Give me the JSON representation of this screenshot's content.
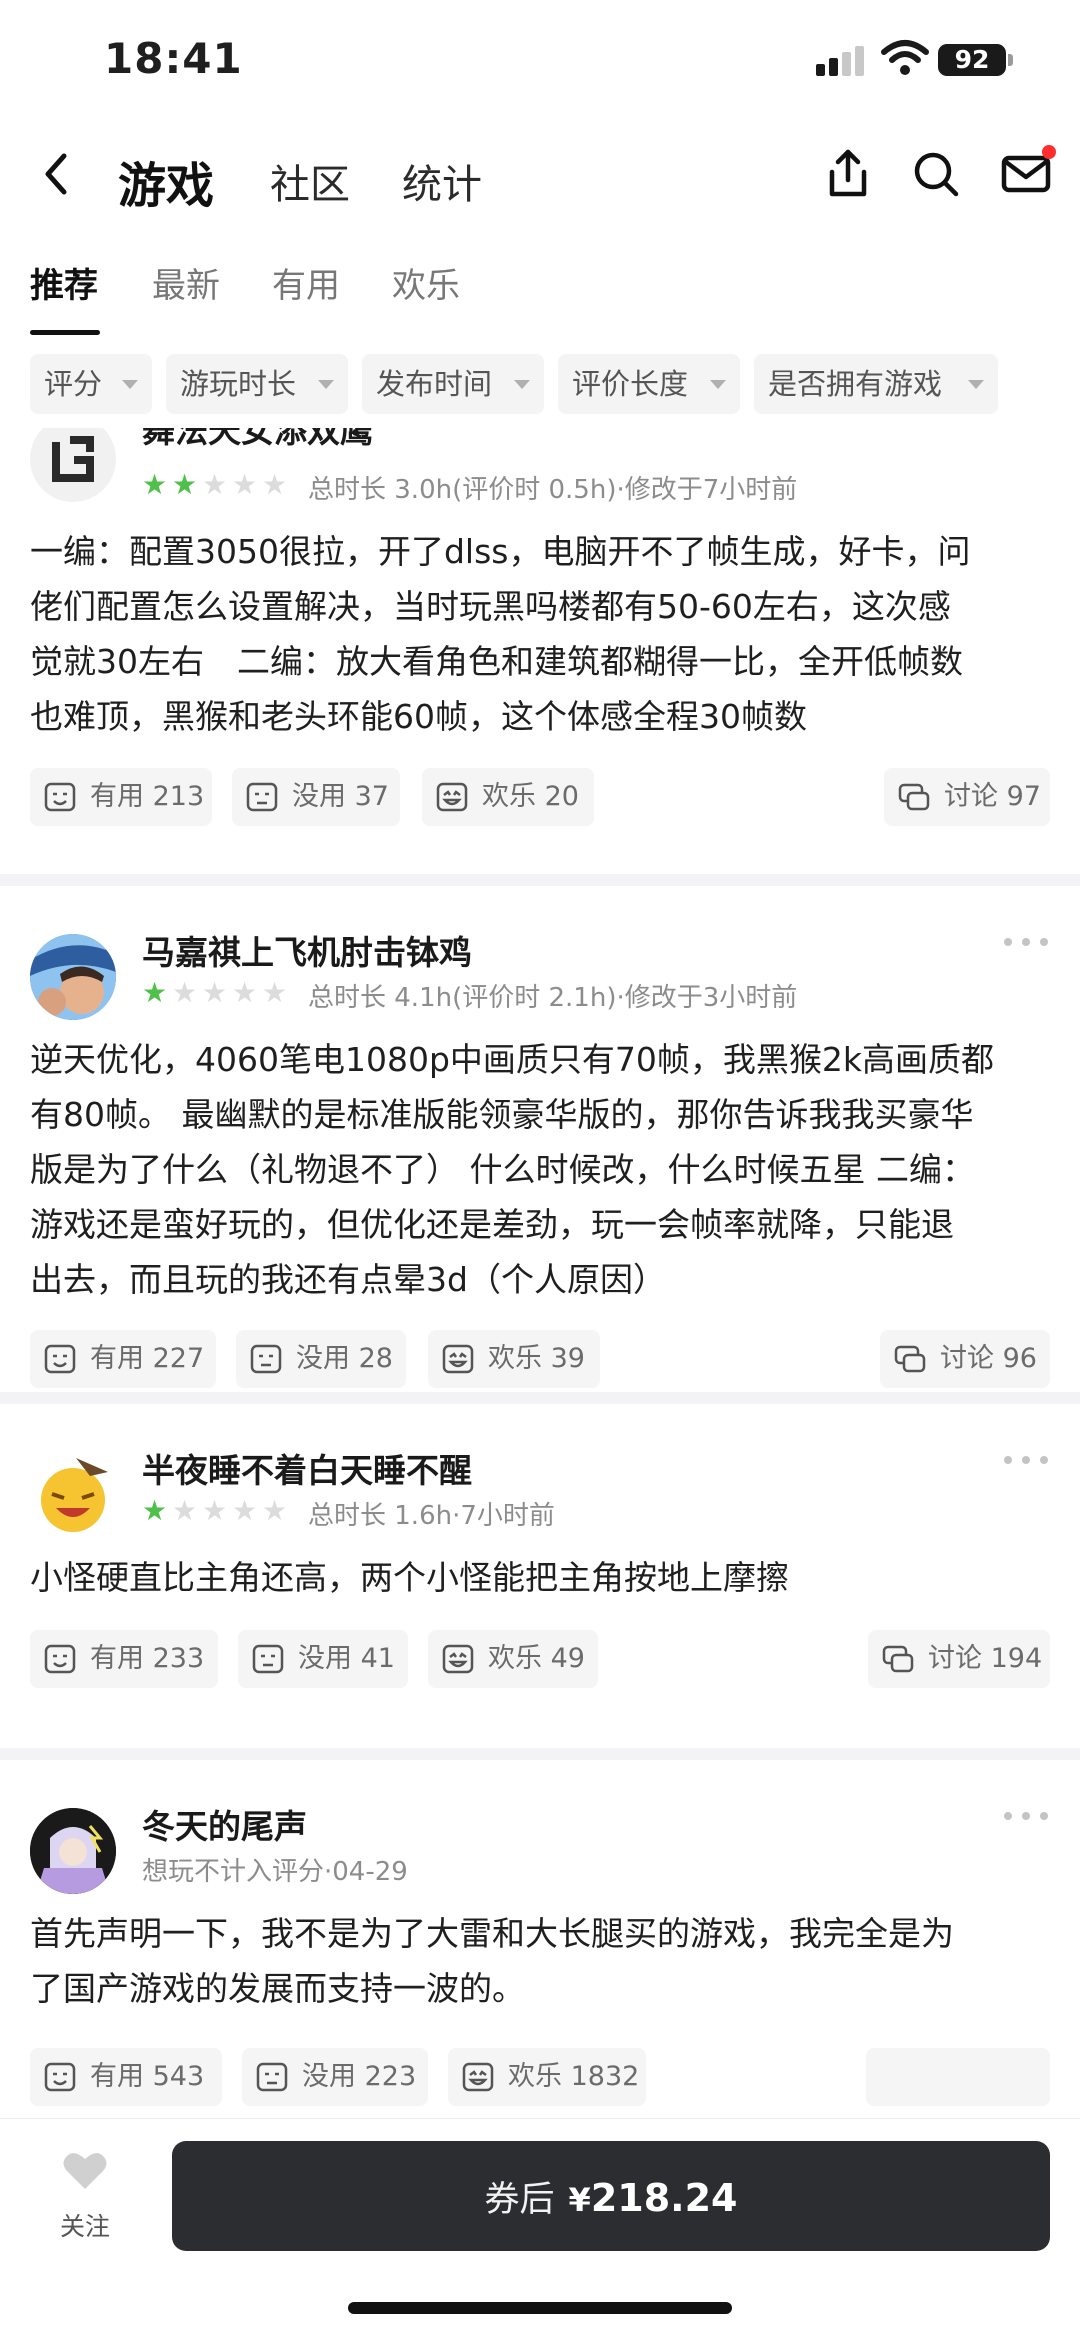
{
  "status_bar": {
    "time": "18:41",
    "battery": "92"
  },
  "nav": {
    "title": "游戏",
    "tabs": [
      {
        "label": "社区"
      },
      {
        "label": "统计"
      }
    ]
  },
  "sub_tabs": [
    {
      "label": "推荐",
      "active": true
    },
    {
      "label": "最新"
    },
    {
      "label": "有用"
    },
    {
      "label": "欢乐"
    }
  ],
  "filters": [
    {
      "label": "评分"
    },
    {
      "label": "游玩时长"
    },
    {
      "label": "发布时间"
    },
    {
      "label": "评价长度"
    },
    {
      "label": "是否拥有游戏"
    }
  ],
  "reviews": [
    {
      "username": "舞法天女添双鹰",
      "stars": 2,
      "meta": "总时长 3.0h(评价时 0.5h)·修改于7小时前",
      "lines": [
        "一编：配置3050很拉，开了dlss，电脑开不了帧生成，好卡，问",
        "佬们配置怎么设置解决，当时玩黑吗楼都有50-60左右，这次感",
        "觉就30左右　二编：放大看角色和建筑都糊得一比，全开低帧数",
        "也难顶，黑猴和老头环能60帧，这个体感全程30帧数"
      ],
      "useful": "有用 213",
      "useless": "没用 37",
      "funny": "欢乐 20",
      "discuss": "讨论 97"
    },
    {
      "username": "马嘉祺上飞机肘击钵鸡",
      "stars": 1,
      "meta": "总时长 4.1h(评价时 2.1h)·修改于3小时前",
      "lines": [
        "逆天优化，4060笔电1080p中画质只有70帧，我黑猴2k高画质都",
        "有80帧。 最幽默的是标准版能领豪华版的，那你告诉我我买豪华",
        "版是为了什么（礼物退不了） 什么时候改，什么时候五星 二编：",
        "游戏还是蛮好玩的，但优化还是差劲，玩一会帧率就降，只能退",
        "出去，而且玩的我还有点晕3d（个人原因）"
      ],
      "useful": "有用 227",
      "useless": "没用 28",
      "funny": "欢乐 39",
      "discuss": "讨论 96"
    },
    {
      "username": "半夜睡不着白天睡不醒",
      "stars": 1,
      "meta": "总时长 1.6h·7小时前",
      "lines": [
        "小怪硬直比主角还高，两个小怪能把主角按地上摩擦"
      ],
      "useful": "有用 233",
      "useless": "没用 41",
      "funny": "欢乐 49",
      "discuss": "讨论 194"
    },
    {
      "username": "冬天的尾声",
      "meta": "想玩不计入评分·04-29",
      "lines": [
        "首先声明一下，我不是为了大雷和大长腿买的游戏，我完全是为",
        "了国产游戏的发展而支持一波的。"
      ],
      "useful": "有用 543",
      "useless": "没用 223",
      "funny": "欢乐 1832"
    }
  ],
  "bottom": {
    "follow_label": "关注",
    "buy_label": "券后",
    "currency": "¥",
    "price": "218.24"
  },
  "colors": {
    "star_on": "#4fc04a",
    "star_off": "#dcdcdc",
    "buy_bg": "#2b2d31",
    "notify_dot": "#ff2d2d"
  }
}
